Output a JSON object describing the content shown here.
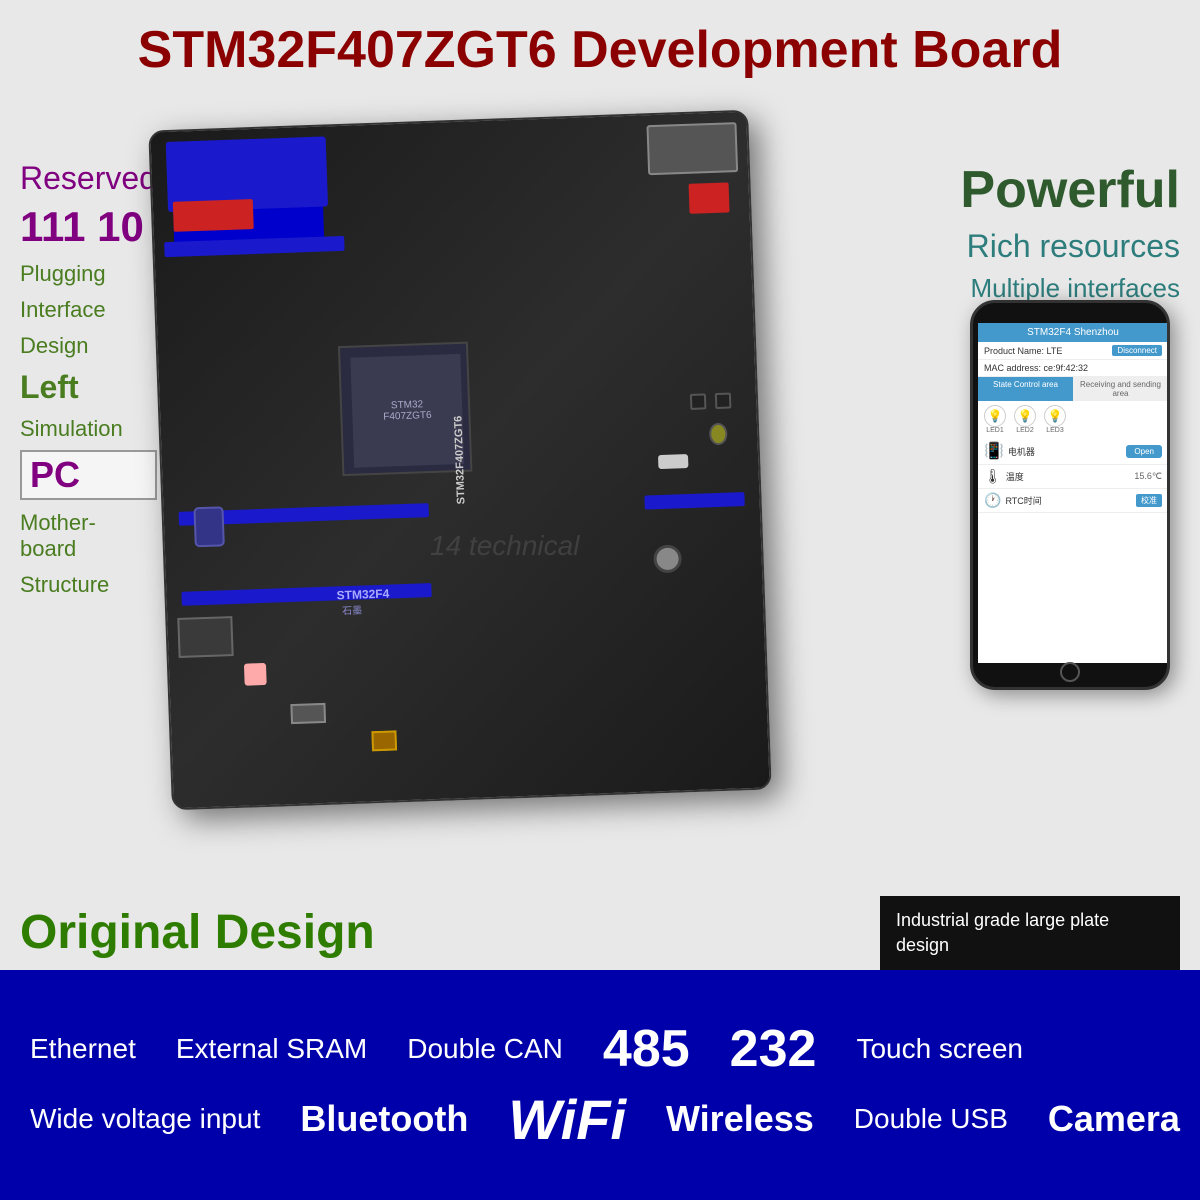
{
  "title": "STM32F407ZGT6 Development Board",
  "left": {
    "reserved": "Reserved",
    "numbers": "111  10",
    "plugging": "Plugging",
    "interface": "Interface",
    "design": "Design",
    "left": "Left",
    "simulation": "Simulation",
    "pc": "PC",
    "motherboard": "Mother-\nboard",
    "structure": "Structure"
  },
  "right": {
    "powerful": "Powerful",
    "rich_resources": "Rich resources",
    "multiple_interfaces": "Multiple interfaces"
  },
  "watermark": "14 technical",
  "original_design": "Original Design",
  "industrial_box": "Industrial grade large plate design",
  "phone": {
    "header": "STM32F4 Shenzhou",
    "product_name": "Product Name: LTE",
    "mac": "MAC address: ce:9f:42:32",
    "disconnect": "Disconnect",
    "tab1": "State Control area",
    "tab2": "Receiving and sending area",
    "led1": "LED1",
    "led2": "LED2",
    "led3": "LED3",
    "motor_label": "电机器",
    "open": "Open",
    "temp_label": "温度",
    "temp_value": "15.6℃",
    "rtc_label": "RTC时间",
    "rtc_btn": "校准"
  },
  "bottom": {
    "row1": {
      "item1": "Ethernet",
      "item2": "External SRAM",
      "item3": "Double CAN",
      "item4": "485",
      "item5": "232",
      "item6": "Touch screen"
    },
    "row2": {
      "item1": "Wide voltage input",
      "item2": "Bluetooth",
      "item3": "WiFi",
      "item4": "Wireless",
      "item5": "Double USB",
      "item6": "Camera"
    }
  }
}
